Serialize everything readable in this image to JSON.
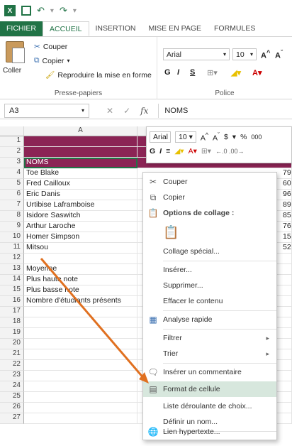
{
  "qat": {
    "app_icon": "excel-icon",
    "save_icon": "save-icon",
    "undo_icon": "undo-icon",
    "redo_icon": "redo-icon"
  },
  "tabs": [
    "FICHIER",
    "ACCUEIL",
    "INSERTION",
    "MISE EN PAGE",
    "FORMULES"
  ],
  "ribbon": {
    "clipboard": {
      "paste_label": "Coller",
      "cut_label": "Couper",
      "copy_label": "Copier",
      "format_painter_label": "Reproduire la mise en forme",
      "group_label": "Presse-papiers"
    },
    "font": {
      "font_name": "Arial",
      "font_size": "10",
      "bold": "G",
      "italic": "I",
      "underline": "S",
      "group_label": "Police"
    }
  },
  "formula_bar": {
    "name_box": "A3",
    "fx_label": "fx",
    "content": "NOMS"
  },
  "columns": [
    "A"
  ],
  "rows": [
    "1",
    "2",
    "3",
    "4",
    "5",
    "6",
    "7",
    "8",
    "9",
    "10",
    "11",
    "12",
    "13",
    "14",
    "15",
    "16",
    "17",
    "18",
    "19",
    "20",
    "21",
    "22",
    "23",
    "24",
    "25",
    "26",
    "27"
  ],
  "cells": {
    "r3": "NOMS",
    "names": [
      "Toe Blake",
      "Fred Cailloux",
      "Eric Danis",
      "Urtibise Laframboise",
      "Isidore Saswitch",
      "Arthur Laroche",
      "Homer Simpson",
      "Mitsou"
    ],
    "r13": "Moyenne",
    "r14": "Plus haute note",
    "r15": "Plus basse note",
    "r16": "Nombre d'étudiants présents",
    "partial_values": [
      "79",
      "60",
      "96",
      "89",
      "85",
      "76",
      "15",
      "52"
    ]
  },
  "mini_toolbar": {
    "font_name": "Arial",
    "font_size": "10",
    "currency": "$",
    "percent": "%",
    "thousands": "000",
    "bold": "G",
    "italic": "I"
  },
  "context_menu": {
    "items": [
      {
        "label": "Couper",
        "icon": "scissors-icon"
      },
      {
        "label": "Copier",
        "icon": "copy-icon"
      },
      {
        "label": "Options de collage :",
        "icon": "paste-icon"
      },
      {
        "label": "",
        "icon": "paste-option-icon"
      },
      {
        "label": "Collage spécial...",
        "icon": ""
      },
      {
        "label": "Insérer...",
        "icon": ""
      },
      {
        "label": "Supprimer...",
        "icon": ""
      },
      {
        "label": "Effacer le contenu",
        "icon": ""
      },
      {
        "label": "Analyse rapide",
        "icon": "quick-analysis-icon"
      },
      {
        "label": "Filtrer",
        "icon": ""
      },
      {
        "label": "Trier",
        "icon": ""
      },
      {
        "label": "Insérer un commentaire",
        "icon": "comment-icon"
      },
      {
        "label": "Format de cellule",
        "icon": "format-cells-icon"
      },
      {
        "label": "Liste déroulante de choix...",
        "icon": ""
      },
      {
        "label": "Définir un nom...",
        "icon": ""
      },
      {
        "label": "Lien hypertexte...",
        "icon": "hyperlink-icon"
      }
    ]
  },
  "colors": {
    "excel_green": "#217346",
    "band": "#8b2455",
    "highlight": "#d7e7dd",
    "arrow": "#e07020"
  }
}
